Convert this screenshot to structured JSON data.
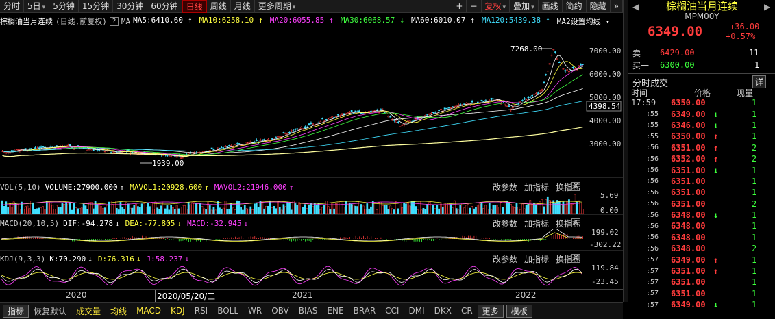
{
  "toolbar": {
    "items": [
      {
        "label": "分时",
        "dd": false
      },
      {
        "label": "5日",
        "dd": true
      },
      {
        "label": "5分钟",
        "dd": false
      },
      {
        "label": "15分钟",
        "dd": false
      },
      {
        "label": "30分钟",
        "dd": false
      },
      {
        "label": "60分钟",
        "dd": false
      },
      {
        "label": "日线",
        "dd": false,
        "active": true
      },
      {
        "label": "周线",
        "dd": false
      },
      {
        "label": "月线",
        "dd": false
      },
      {
        "label": "更多周期",
        "dd": true
      }
    ],
    "right": [
      {
        "label": "+",
        "dd": false
      },
      {
        "label": "−",
        "dd": false
      },
      {
        "label": "复权",
        "dd": true,
        "red": true
      },
      {
        "label": "叠加",
        "dd": true
      },
      {
        "label": "画线",
        "dd": false
      },
      {
        "label": "简约",
        "dd": false
      },
      {
        "label": "隐藏",
        "dd": false
      }
    ]
  },
  "info": {
    "title": "棕榈油当月连续",
    "mode": "(日线,前复权)",
    "q": "?",
    "ma_label": "MA",
    "mas": [
      {
        "text": "MA5:6410.60",
        "color": "#ffffff",
        "arrow": "↑"
      },
      {
        "text": "MA10:6258.10",
        "color": "#ffff40",
        "arrow": "↑"
      },
      {
        "text": "MA20:6055.85",
        "color": "#ff40ff",
        "arrow": "↑"
      },
      {
        "text": "MA30:6068.57",
        "color": "#40ff40",
        "arrow": "↓"
      },
      {
        "text": "MA60:6010.07",
        "color": "#ffffff",
        "arrow": "↑"
      },
      {
        "text": "MA120:5439.38",
        "color": "#40e0ff",
        "arrow": "↑"
      },
      {
        "text": "MA2设置均线",
        "color": "#ffffff",
        "arrow": "▾"
      }
    ]
  },
  "main_chart": {
    "y_ticks": [
      "7000.00",
      "6000.00",
      "5000.00",
      "4000.00",
      "3000.00"
    ],
    "y_values": [
      7000,
      6000,
      5000,
      4000,
      3000
    ],
    "ylim": [
      2450,
      7500
    ],
    "current_price": "4398.54",
    "high_label": "7268.00",
    "low_label": "1939.00"
  },
  "vol_panel": {
    "label": "VOL(5,10)",
    "items": [
      {
        "text": "VOLUME:27900.000",
        "color": "#ffffff",
        "arrow": "↑"
      },
      {
        "text": "MAVOL1:20928.600",
        "color": "#ffff40",
        "arrow": "↑"
      },
      {
        "text": "MAVOL2:21946.000",
        "color": "#ff40ff",
        "arrow": "↑"
      }
    ],
    "y_ticks": [
      "5.69",
      "0.00"
    ]
  },
  "macd_panel": {
    "label": "MACD(20,10,5)",
    "items": [
      {
        "text": "DIF:-94.278",
        "color": "#ffffff",
        "arrow": "↓"
      },
      {
        "text": "DEA:-77.805",
        "color": "#ffff40",
        "arrow": "↓"
      },
      {
        "text": "MACD:-32.945",
        "color": "#ff40ff",
        "arrow": "↓"
      }
    ],
    "y_ticks": [
      "199.02",
      "-302.22"
    ]
  },
  "kdj_panel": {
    "label": "KDJ(9,3,3)",
    "items": [
      {
        "text": "K:70.290",
        "color": "#ffffff",
        "arrow": "↓"
      },
      {
        "text": "D:76.316",
        "color": "#ffff40",
        "arrow": "↓"
      },
      {
        "text": "J:58.237",
        "color": "#ff40ff",
        "arrow": "↓"
      }
    ],
    "y_ticks": [
      "119.84",
      "-23.45"
    ]
  },
  "panel_buttons": [
    "改参数",
    "加指标",
    "换指标"
  ],
  "close_glyph": "X",
  "x_axis": {
    "labels": [
      "2020",
      "2020/05/20/三",
      "2021",
      "2022"
    ]
  },
  "bottom_tabs": [
    {
      "label": "指标",
      "style": "box"
    },
    {
      "label": "恢复默认"
    },
    {
      "label": "成交量",
      "hl": true
    },
    {
      "label": "均线",
      "hl": true
    },
    {
      "label": "MACD",
      "hl": true
    },
    {
      "label": "KDJ",
      "hl": true
    },
    {
      "label": "RSI"
    },
    {
      "label": "BOLL"
    },
    {
      "label": "WR"
    },
    {
      "label": "OBV"
    },
    {
      "label": "BIAS"
    },
    {
      "label": "ENE"
    },
    {
      "label": "BRAR"
    },
    {
      "label": "CCI"
    },
    {
      "label": "DMI"
    },
    {
      "label": "DKX"
    },
    {
      "label": "CR"
    },
    {
      "label": "更多",
      "style": "box"
    },
    {
      "label": "模板",
      "style": "box"
    }
  ],
  "right_panel": {
    "name": "棕榈油当月连续",
    "code": "MPM00Y",
    "price": "6349.00",
    "change": "+36.00",
    "change_pct": "+0.57%",
    "sell_label": "卖一",
    "sell_price": "6429.00",
    "sell_qty": "11",
    "buy_label": "买一",
    "buy_price": "6300.00",
    "buy_qty": "1",
    "ticks_title": "分时成交",
    "detail_btn": "详",
    "col_time": "时间",
    "col_price": "价格",
    "col_vol": "现量",
    "ticks": [
      {
        "t": "17:59",
        "p": "6350.00",
        "a": "",
        "v": "1"
      },
      {
        "t": ":55",
        "p": "6349.00",
        "a": "↓",
        "v": "1"
      },
      {
        "t": ":55",
        "p": "6346.00",
        "a": "↓",
        "v": "1"
      },
      {
        "t": ":55",
        "p": "6350.00",
        "a": "↑",
        "v": "1"
      },
      {
        "t": ":56",
        "p": "6351.00",
        "a": "↑",
        "v": "2"
      },
      {
        "t": ":56",
        "p": "6352.00",
        "a": "↑",
        "v": "2"
      },
      {
        "t": ":56",
        "p": "6351.00",
        "a": "↓",
        "v": "1"
      },
      {
        "t": ":56",
        "p": "6351.00",
        "a": "",
        "v": "1"
      },
      {
        "t": ":56",
        "p": "6351.00",
        "a": "",
        "v": "1"
      },
      {
        "t": ":56",
        "p": "6351.00",
        "a": "",
        "v": "2"
      },
      {
        "t": ":56",
        "p": "6348.00",
        "a": "↓",
        "v": "1"
      },
      {
        "t": ":56",
        "p": "6348.00",
        "a": "",
        "v": "1"
      },
      {
        "t": ":56",
        "p": "6348.00",
        "a": "",
        "v": "1"
      },
      {
        "t": ":56",
        "p": "6348.00",
        "a": "",
        "v": "2"
      },
      {
        "t": ":57",
        "p": "6349.00",
        "a": "↑",
        "v": "1"
      },
      {
        "t": ":57",
        "p": "6351.00",
        "a": "↑",
        "v": "1"
      },
      {
        "t": ":57",
        "p": "6351.00",
        "a": "",
        "v": "1"
      },
      {
        "t": ":57",
        "p": "6351.00",
        "a": "",
        "v": "1"
      },
      {
        "t": ":57",
        "p": "6349.00",
        "a": "↓",
        "v": "1"
      }
    ]
  },
  "colors": {
    "up": "#ff3c3c",
    "down": "#40e0ff",
    "accent": "#ff4040",
    "green": "#3cff3c",
    "yellow": "#ffff40",
    "magenta": "#ff40ff"
  }
}
